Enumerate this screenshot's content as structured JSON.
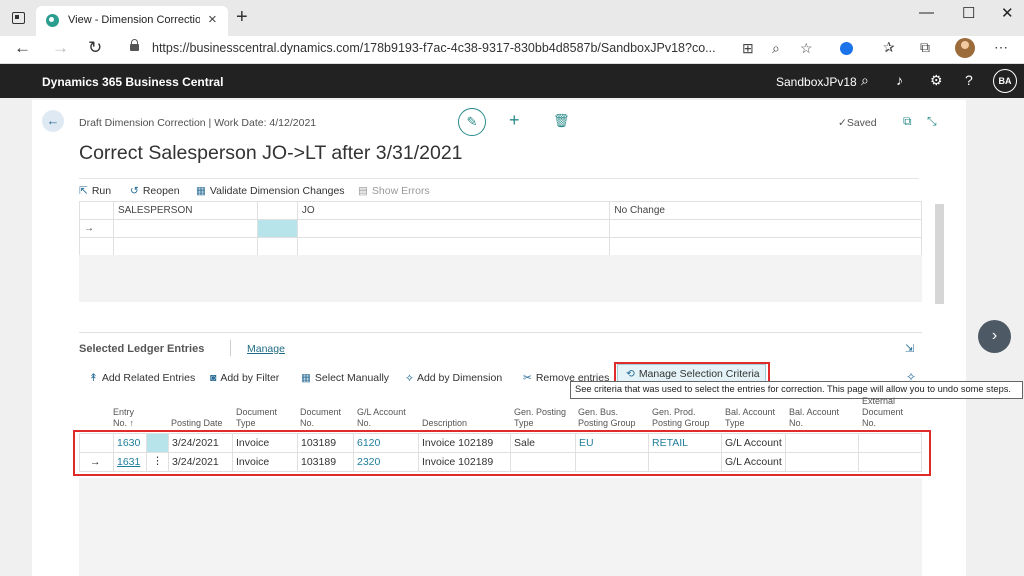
{
  "browser": {
    "tab_title": "View - Dimension Corrections - D",
    "url": "https://businesscentral.dynamics.com/178b9193-f7ac-4c38-9317-830bb4d8587b/SandboxJPv18?co..."
  },
  "app": {
    "title": "Dynamics 365 Business Central",
    "company": "SandboxJPv18",
    "user_initials": "BA"
  },
  "page": {
    "breadcrumb": "Draft Dimension Correction | Work Date: 4/12/2021",
    "title": "Correct Salesperson JO->LT after 3/31/2021",
    "saved_label": "Saved"
  },
  "actions": {
    "run": "Run",
    "reopen": "Reopen",
    "validate": "Validate Dimension Changes",
    "show_errors": "Show Errors"
  },
  "dimension_lines": [
    {
      "dimension": "SALESPERSON",
      "old_value": "JO",
      "new_value": "No Change"
    }
  ],
  "ledger": {
    "section_title": "Selected Ledger Entries",
    "manage_link": "Manage",
    "actions": {
      "add_related": "Add Related Entries",
      "add_by_filter": "Add by Filter",
      "select_manually": "Select Manually",
      "add_by_dimension": "Add by Dimension",
      "remove_entries": "Remove entries",
      "manage_criteria": "Manage Selection Criteria"
    },
    "tooltip": "See criteria that was used to select the entries for correction. This page will allow you to undo some steps.",
    "columns": {
      "entry_no_1": "Entry",
      "entry_no_2": "No. ↑",
      "posting_date": "Posting Date",
      "doc_type_1": "Document",
      "doc_type_2": "Type",
      "doc_no_1": "Document",
      "doc_no_2": "No.",
      "gl_acc_1": "G/L Account",
      "gl_acc_2": "No.",
      "description": "Description",
      "gen_post_1": "Gen. Posting",
      "gen_post_2": "Type",
      "gen_bus_1": "Gen. Bus.",
      "gen_bus_2": "Posting Group",
      "gen_prod_1": "Gen. Prod.",
      "gen_prod_2": "Posting Group",
      "bal_type_1": "Bal. Account",
      "bal_type_2": "Type",
      "bal_no_1": "Bal. Account",
      "bal_no_2": "No.",
      "ext_doc_1": "External",
      "ext_doc_2": "Document",
      "ext_doc_3": "No."
    },
    "rows": [
      {
        "entry_no": "1630",
        "posting_date": "3/24/2021",
        "doc_type": "Invoice",
        "doc_no": "103189",
        "gl_account": "6120",
        "description": "Invoice 102189",
        "gen_posting_type": "Sale",
        "gen_bus": "EU",
        "gen_prod": "RETAIL",
        "bal_type": "G/L Account",
        "bal_no": "",
        "ext_doc": ""
      },
      {
        "entry_no": "1631",
        "posting_date": "3/24/2021",
        "doc_type": "Invoice",
        "doc_no": "103189",
        "gl_account": "2320",
        "description": "Invoice 102189",
        "gen_posting_type": "",
        "gen_bus": "",
        "gen_prod": "",
        "bal_type": "G/L Account",
        "bal_no": "",
        "ext_doc": ""
      }
    ]
  },
  "icons": {
    "back": "←",
    "edit": "✎",
    "add": "+",
    "delete": "🗑",
    "next": "›"
  }
}
